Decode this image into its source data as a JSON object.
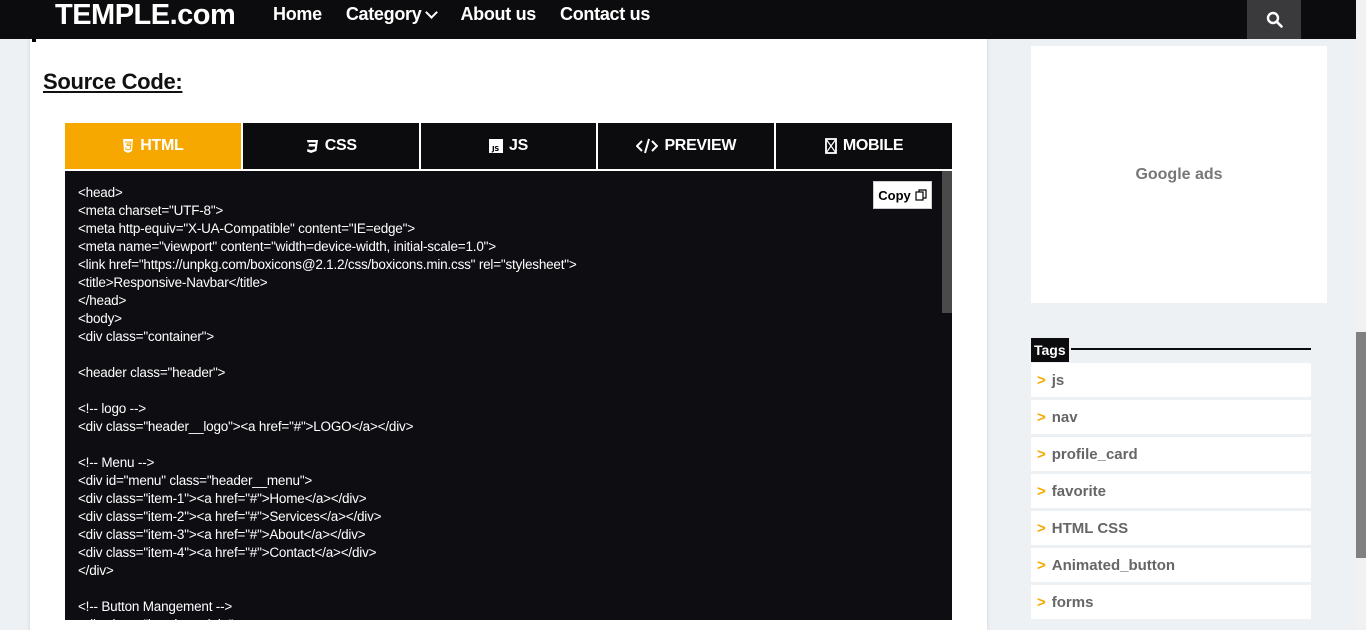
{
  "header": {
    "logo": "TEMPLE.com",
    "nav": [
      {
        "label": "Home"
      },
      {
        "label": "Category",
        "has_dropdown": true
      },
      {
        "label": "About us"
      },
      {
        "label": "Contact us"
      }
    ],
    "search_icon": "search-icon"
  },
  "main": {
    "section_title": "Source Code:",
    "tabs": [
      {
        "label": "HTML",
        "icon": "html5-icon",
        "active": true
      },
      {
        "label": "CSS",
        "icon": "css3-icon",
        "active": false
      },
      {
        "label": "JS",
        "icon": "js-icon",
        "active": false
      },
      {
        "label": "PREVIEW",
        "icon": "code-icon",
        "active": false
      },
      {
        "label": "MOBILE",
        "icon": "mobile-icon",
        "active": false
      }
    ],
    "copy_label": "Copy",
    "code_lines": [
      "<head>",
      "<meta charset=\"UTF-8\">",
      "<meta http-equiv=\"X-UA-Compatible\" content=\"IE=edge\">",
      "<meta name=\"viewport\" content=\"width=device-width, initial-scale=1.0\">",
      "<link href=\"https://unpkg.com/boxicons@2.1.2/css/boxicons.min.css\" rel=\"stylesheet\">",
      "<title>Responsive-Navbar</title>",
      "</head>",
      "<body>",
      "<div class=\"container\">",
      "",
      "<header class=\"header\">",
      "",
      "<!-- logo -->",
      "<div class=\"header__logo\"><a href=\"#\">LOGO</a></div>",
      "",
      "<!-- Menu -->",
      "<div id=\"menu\" class=\"header__menu\">",
      "<div class=\"item-1\"><a href=\"#\">Home</a></div>",
      "<div class=\"item-2\"><a href=\"#\">Services</a></div>",
      "<div class=\"item-3\"><a href=\"#\">About</a></div>",
      "<div class=\"item-4\"><a href=\"#\">Contact</a></div>",
      "</div>",
      "",
      "<!-- Button Mangement -->",
      "<div class=\"header__right\">"
    ]
  },
  "sidebar": {
    "ads_label": "Google ads",
    "tags_title": "Tags",
    "tags": [
      "js",
      "nav",
      "profile_card",
      "favorite",
      "HTML CSS",
      "Animated_button",
      "forms"
    ]
  },
  "colors": {
    "accent": "#f7a800",
    "dark": "#0c0c0e",
    "code_bg": "#0e0d12"
  }
}
